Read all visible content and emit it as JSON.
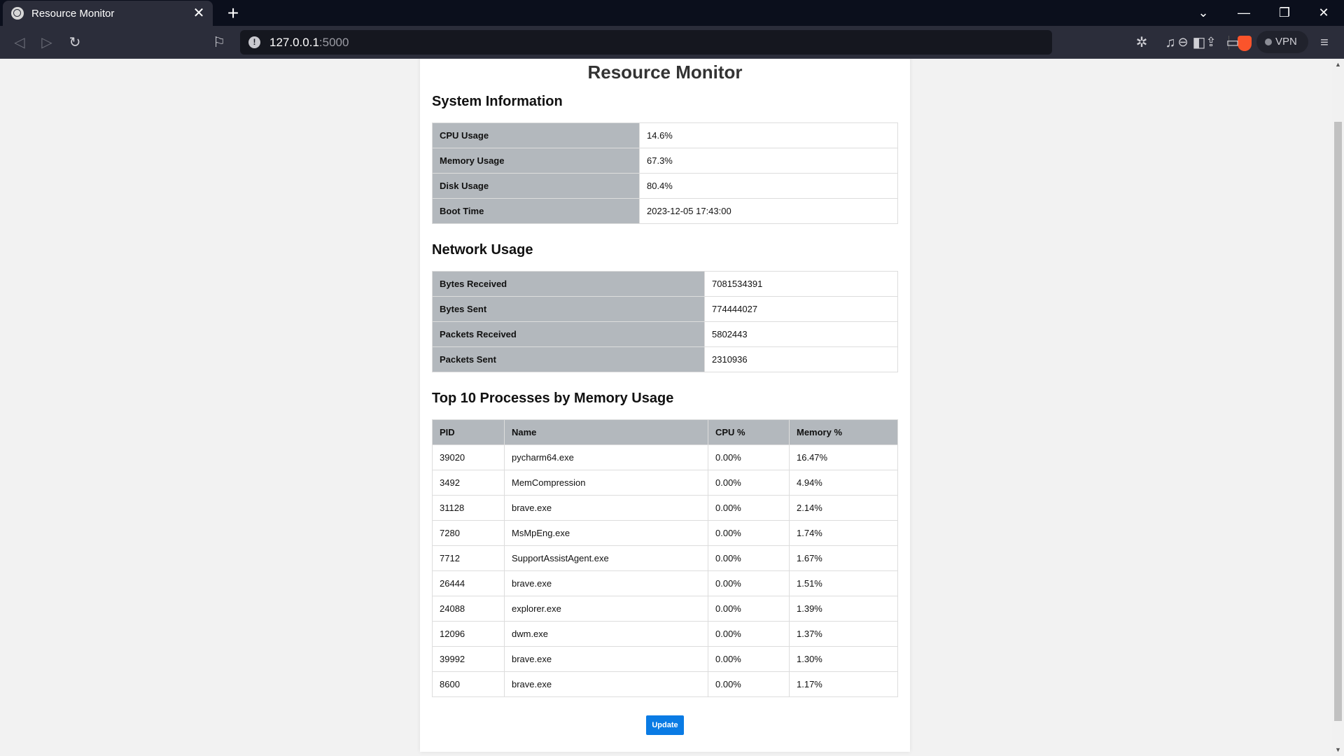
{
  "browser": {
    "tab_title": "Resource Monitor",
    "url_host": "127.0.0.1",
    "url_port": ":5000",
    "vpn_label": "VPN"
  },
  "page": {
    "title": "Resource Monitor",
    "system": {
      "heading": "System Information",
      "rows": [
        {
          "key": "CPU Usage",
          "value": "14.6%"
        },
        {
          "key": "Memory Usage",
          "value": "67.3%"
        },
        {
          "key": "Disk Usage",
          "value": "80.4%"
        },
        {
          "key": "Boot Time",
          "value": "2023-12-05 17:43:00"
        }
      ]
    },
    "network": {
      "heading": "Network Usage",
      "rows": [
        {
          "key": "Bytes Received",
          "value": "7081534391"
        },
        {
          "key": "Bytes Sent",
          "value": "774444027"
        },
        {
          "key": "Packets Received",
          "value": "5802443"
        },
        {
          "key": "Packets Sent",
          "value": "2310936"
        }
      ]
    },
    "processes": {
      "heading": "Top 10 Processes by Memory Usage",
      "columns": [
        "PID",
        "Name",
        "CPU %",
        "Memory %"
      ],
      "rows": [
        [
          "39020",
          "pycharm64.exe",
          "0.00%",
          "16.47%"
        ],
        [
          "3492",
          "MemCompression",
          "0.00%",
          "4.94%"
        ],
        [
          "31128",
          "brave.exe",
          "0.00%",
          "2.14%"
        ],
        [
          "7280",
          "MsMpEng.exe",
          "0.00%",
          "1.74%"
        ],
        [
          "7712",
          "SupportAssistAgent.exe",
          "0.00%",
          "1.67%"
        ],
        [
          "26444",
          "brave.exe",
          "0.00%",
          "1.51%"
        ],
        [
          "24088",
          "explorer.exe",
          "0.00%",
          "1.39%"
        ],
        [
          "12096",
          "dwm.exe",
          "0.00%",
          "1.37%"
        ],
        [
          "39992",
          "brave.exe",
          "0.00%",
          "1.30%"
        ],
        [
          "8600",
          "brave.exe",
          "0.00%",
          "1.17%"
        ]
      ]
    },
    "update_label": "Update"
  }
}
